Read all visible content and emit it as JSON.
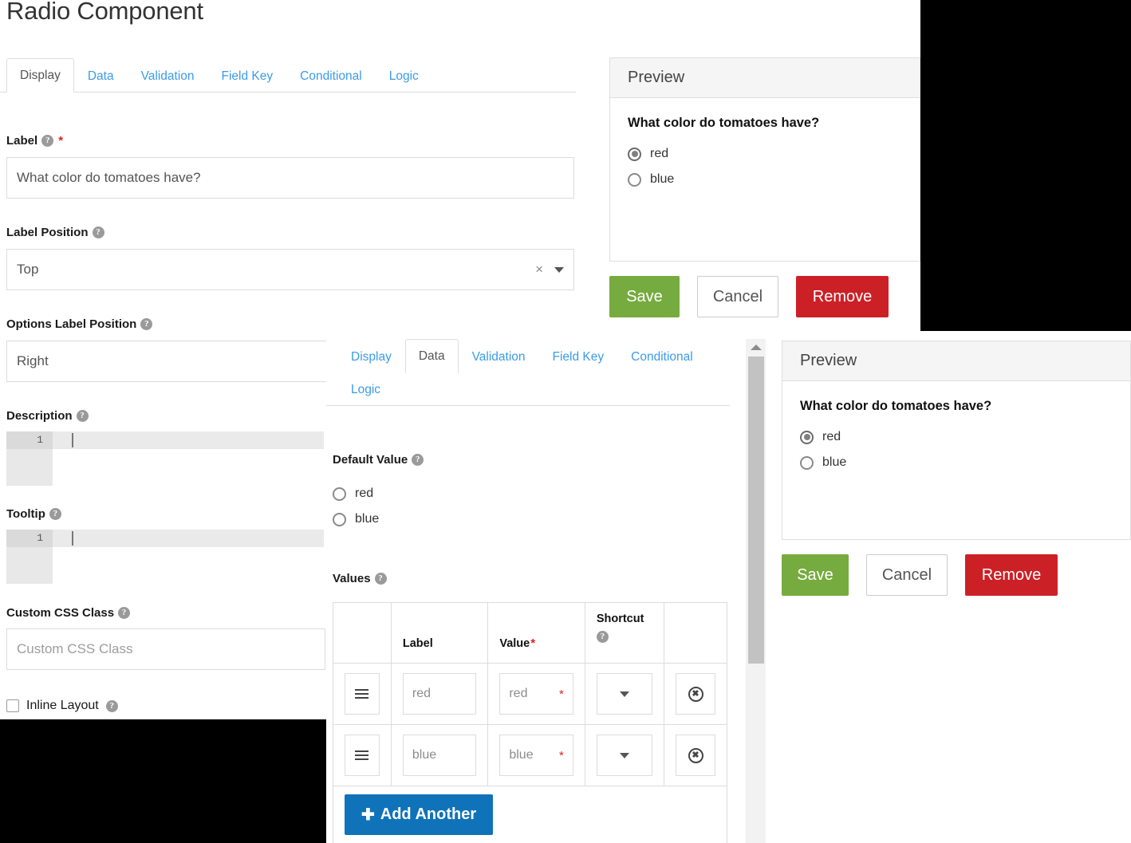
{
  "page": {
    "title": "Radio Component"
  },
  "display_tab": {
    "tabs": [
      {
        "label": "Display",
        "active": true
      },
      {
        "label": "Data",
        "active": false
      },
      {
        "label": "Validation",
        "active": false
      },
      {
        "label": "Field Key",
        "active": false
      },
      {
        "label": "Conditional",
        "active": false
      },
      {
        "label": "Logic",
        "active": false
      }
    ],
    "label_field": {
      "label": "Label",
      "required": true,
      "value": "What color do tomatoes have?"
    },
    "label_position": {
      "label": "Label Position",
      "value": "Top",
      "clear_glyph": "×"
    },
    "options_label_position": {
      "label": "Options Label Position",
      "value": "Right"
    },
    "description": {
      "label": "Description",
      "line_number": "1"
    },
    "tooltip": {
      "label": "Tooltip",
      "line_number": "1"
    },
    "custom_css_class": {
      "label": "Custom CSS Class",
      "placeholder": "Custom CSS Class"
    },
    "inline_layout": {
      "label": "Inline Layout",
      "checked": false
    }
  },
  "data_tab": {
    "tabs": [
      {
        "label": "Display",
        "active": false
      },
      {
        "label": "Data",
        "active": true
      },
      {
        "label": "Validation",
        "active": false
      },
      {
        "label": "Field Key",
        "active": false
      },
      {
        "label": "Conditional",
        "active": false
      },
      {
        "label": "Logic",
        "active": false
      }
    ],
    "default_value": {
      "label": "Default Value",
      "options": [
        {
          "label": "red",
          "checked": false
        },
        {
          "label": "blue",
          "checked": false
        }
      ]
    },
    "values": {
      "label": "Values",
      "columns": {
        "handle": "",
        "label": "Label",
        "value": "Value",
        "value_required": true,
        "shortcut": "Shortcut",
        "remove": ""
      },
      "rows": [
        {
          "label": "red",
          "value": "red",
          "shortcut": ""
        },
        {
          "label": "blue",
          "value": "blue",
          "shortcut": ""
        }
      ],
      "add_another_label": "Add Another",
      "add_another_glyph": "✚"
    }
  },
  "preview_top": {
    "header": "Preview",
    "question": "What color do tomatoes have?",
    "options": [
      {
        "label": "red",
        "checked": true
      },
      {
        "label": "blue",
        "checked": false
      }
    ],
    "buttons": {
      "save": "Save",
      "cancel": "Cancel",
      "remove": "Remove"
    }
  },
  "preview_bottom": {
    "header": "Preview",
    "question": "What color do tomatoes have?",
    "options": [
      {
        "label": "red",
        "checked": true
      },
      {
        "label": "blue",
        "checked": false
      }
    ],
    "buttons": {
      "save": "Save",
      "cancel": "Cancel",
      "remove": "Remove"
    }
  },
  "colors": {
    "link": "#3c9be8",
    "save_green": "#76ab3f",
    "remove_red": "#cc2027",
    "add_blue": "#1073ba",
    "required_red": "#e02020"
  },
  "icons": {
    "help": "?",
    "drag_handle": "hamburger-icon",
    "remove_row": "×"
  }
}
